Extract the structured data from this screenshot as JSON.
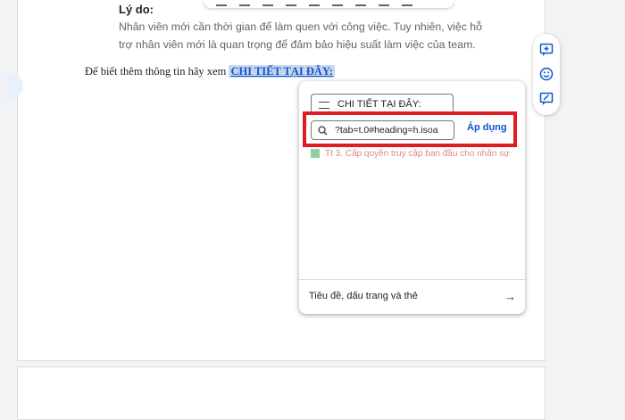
{
  "document": {
    "reason_label": "Lý do:",
    "reason_text": "Nhân viên mới cần thời gian để làm quen với công việc. Tuy nhiên, việc hỗ trợ nhân viên mới là quan trọng để đảm bảo hiệu suất làm việc của team.",
    "info_text": "Để biết thêm thông tin hãy xem",
    "link_text": "CHI TIẾT TẠI ĐÂY:"
  },
  "link_popup": {
    "text_value": "CHI TIẾT TẠI ĐÂY:",
    "link_value": "?tab=t.0#heading=h.isoa",
    "apply_label": "Áp dụng",
    "suggestion_text": "Tt  3. Cấp quyền truy cập ban đầu cho nhân sự",
    "footer_label": "Tiêu đề, dấu trang và thẻ",
    "footer_arrow": "→"
  },
  "colors": {
    "link": "#1155cc",
    "accent": "#0b57d0",
    "highlight_border": "#e21b22"
  },
  "side_toolbar": {
    "icons": [
      "add-comment-icon",
      "emoji-icon",
      "suggest-edit-icon"
    ]
  }
}
